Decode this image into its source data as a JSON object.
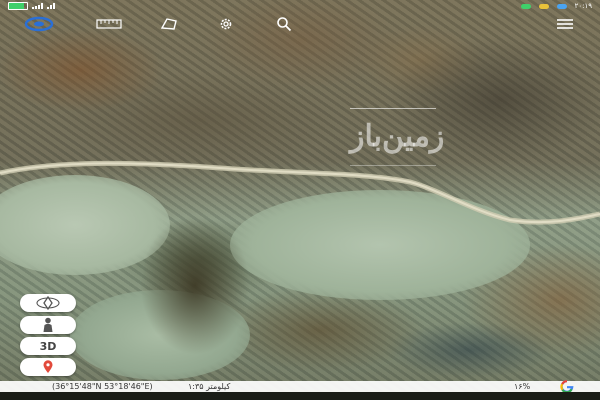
{
  "status_bar": {
    "time": "۲۰:۱۹",
    "battery_level": 0.85
  },
  "toolbar": {
    "items": [
      {
        "name": "layers-button",
        "icon": "layers-icon"
      },
      {
        "name": "ruler-button",
        "icon": "ruler-icon"
      },
      {
        "name": "measure-area-button",
        "icon": "polygon-icon"
      },
      {
        "name": "settings-button",
        "icon": "gear-icon"
      },
      {
        "name": "search-button",
        "icon": "search-icon"
      },
      {
        "name": "menu-button",
        "icon": "menu-icon"
      }
    ]
  },
  "watermark": {
    "text": "زمین‌باز"
  },
  "side_buttons": {
    "compass_icon": "compass-icon",
    "street_view_icon": "pegman-icon",
    "view_3d_label": "3D",
    "location_icon": "location-pin-icon"
  },
  "info_bar": {
    "coordinates": "(36°15'48\"N 53°18'46\"E)",
    "scale": "کیلومتر ۱:۳۵",
    "zoom": "۱۶%"
  },
  "colors": {
    "accent": "#2a6fd6",
    "battery": "#3fd06a",
    "google_blue": "#4285f4",
    "google_red": "#ea4335",
    "google_yellow": "#fbbc05",
    "google_green": "#34a853"
  }
}
